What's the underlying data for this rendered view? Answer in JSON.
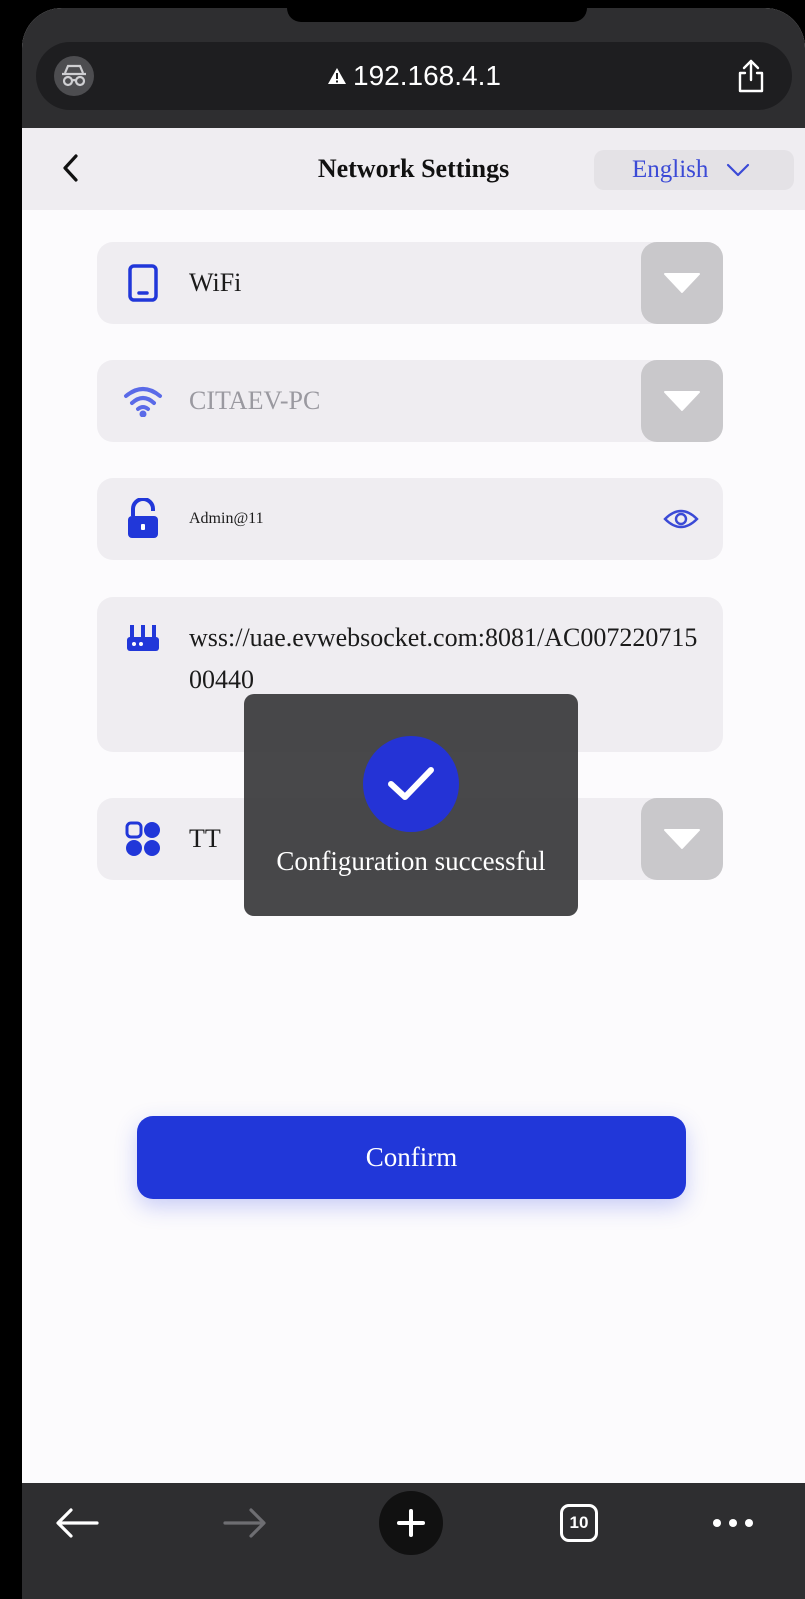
{
  "browser": {
    "url": "192.168.4.1",
    "tab_count": "10"
  },
  "header": {
    "title": "Network Settings",
    "language": "English"
  },
  "fields": {
    "network_type": "WiFi",
    "ssid": "CITAEV-PC",
    "password": "Admin@11",
    "server_url": "wss://uae.evwebsocket.com:8081/AC00722071500440",
    "protocol": "TT"
  },
  "toast": {
    "message": "Configuration successful"
  },
  "confirm_label": "Confirm",
  "colors": {
    "accent": "#2137d9",
    "field_bg": "#efedf1",
    "dropdown_button": "#c9c8cb",
    "toast_bg": "#3a3a3c"
  },
  "icons": {
    "network_type": "tablet-icon",
    "ssid": "wifi-icon",
    "password": "lock-icon",
    "server_url": "router-icon",
    "protocol": "apps-icon"
  }
}
